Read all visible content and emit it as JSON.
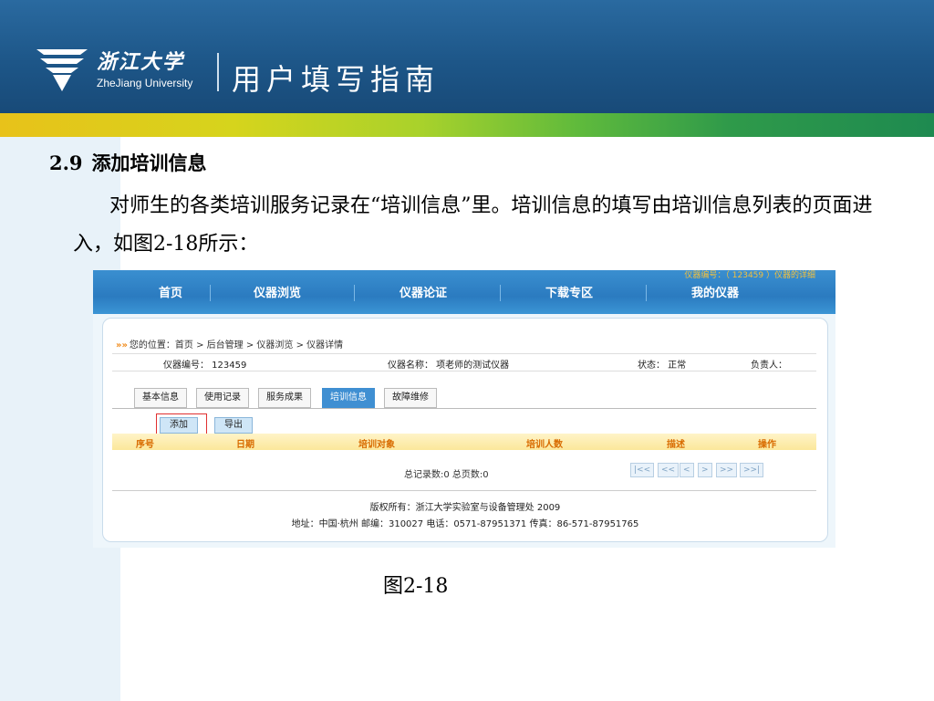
{
  "header": {
    "logo_cn": "浙江大学",
    "logo_en": "ZheJiang University",
    "title": "用户填写指南",
    "colors": {
      "banner": "#1d5688",
      "bar_start": "#e8c21a",
      "bar_end": "#1e8a50"
    }
  },
  "section": {
    "number": "2.9",
    "title": "添加培训信息",
    "paragraph": "对师生的各类培训服务记录在“培训信息”里。培训信息的填写由培训信息列表的页面进入，如图2-18所示："
  },
  "screenshot": {
    "top_link": "仪器编号：（ 123459 ）仪器的详细",
    "nav": [
      "首页",
      "仪器浏览",
      "仪器论证",
      "下载专区",
      "我的仪器"
    ],
    "breadcrumb": "您的位置：首页 > 后台管理 > 仪器浏览 > 仪器详情",
    "info": {
      "instrument_no": "仪器编号： 123459",
      "instrument_name": "仪器名称： 项老师的测试仪器",
      "status": "状态： 正常",
      "owner": "负责人："
    },
    "tabs": [
      "基本信息",
      "使用记录",
      "服务成果",
      "培训信息",
      "故障维修"
    ],
    "active_tab_index": 3,
    "buttons": {
      "add": "添加",
      "export": "导出"
    },
    "columns": [
      "序号",
      "日期",
      "培训对象",
      "培训人数",
      "描述",
      "操作"
    ],
    "summary": "总记录数:0 总页数:0",
    "pager": [
      "|<<",
      "<<",
      "<",
      ">",
      ">>",
      ">>|"
    ],
    "footer": {
      "copyright": "版权所有：浙江大学实验室与设备管理处 2009",
      "address": "地址：中国·杭州 邮编：310027 电话：0571-87951371 传真：86-571-87951765"
    }
  },
  "caption": "图2-18"
}
